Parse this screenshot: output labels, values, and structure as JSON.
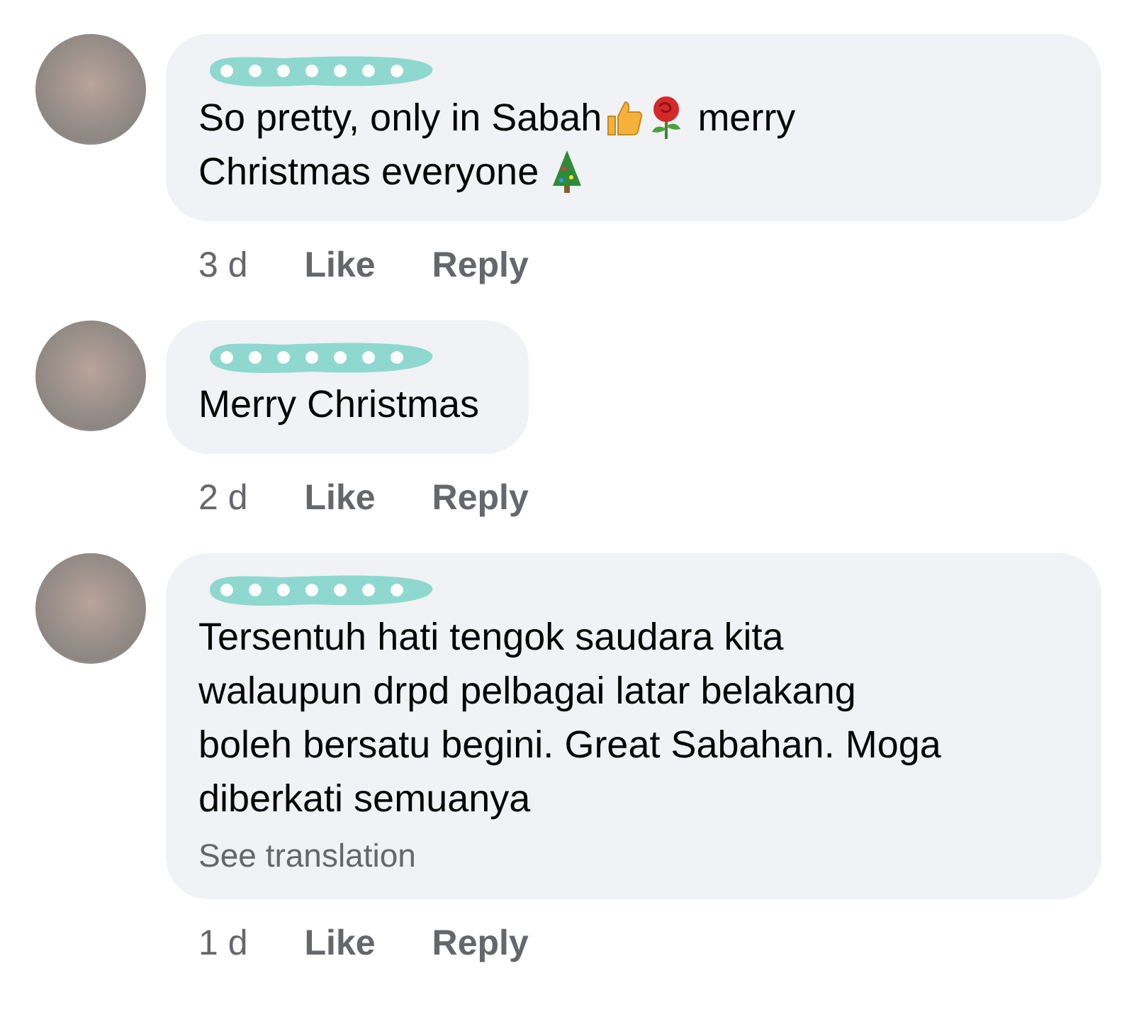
{
  "comments": [
    {
      "name_redacted": true,
      "lines": [
        [
          {
            "kind": "text",
            "text": "So pretty, only in Sabah"
          },
          {
            "kind": "thumbs-up"
          },
          {
            "kind": "rose"
          },
          {
            "kind": "text",
            "text": " merry"
          }
        ],
        [
          {
            "kind": "text",
            "text": "Christmas everyone "
          },
          {
            "kind": "tree"
          }
        ]
      ],
      "time": "3 d",
      "like": "Like",
      "reply": "Reply"
    },
    {
      "name_redacted": true,
      "lines": [
        [
          {
            "kind": "text",
            "text": "Merry Christmas"
          }
        ]
      ],
      "time": "2 d",
      "like": "Like",
      "reply": "Reply"
    },
    {
      "name_redacted": true,
      "lines": [
        [
          {
            "kind": "text",
            "text": "Tersentuh hati tengok saudara kita"
          }
        ],
        [
          {
            "kind": "text",
            "text": "walaupun drpd pelbagai latar belakang"
          }
        ],
        [
          {
            "kind": "text",
            "text": "boleh bersatu begini. Great Sabahan. Moga"
          }
        ],
        [
          {
            "kind": "text",
            "text": "diberkati semuanya"
          }
        ]
      ],
      "translation": "See translation",
      "time": "1 d",
      "like": "Like",
      "reply": "Reply"
    }
  ]
}
